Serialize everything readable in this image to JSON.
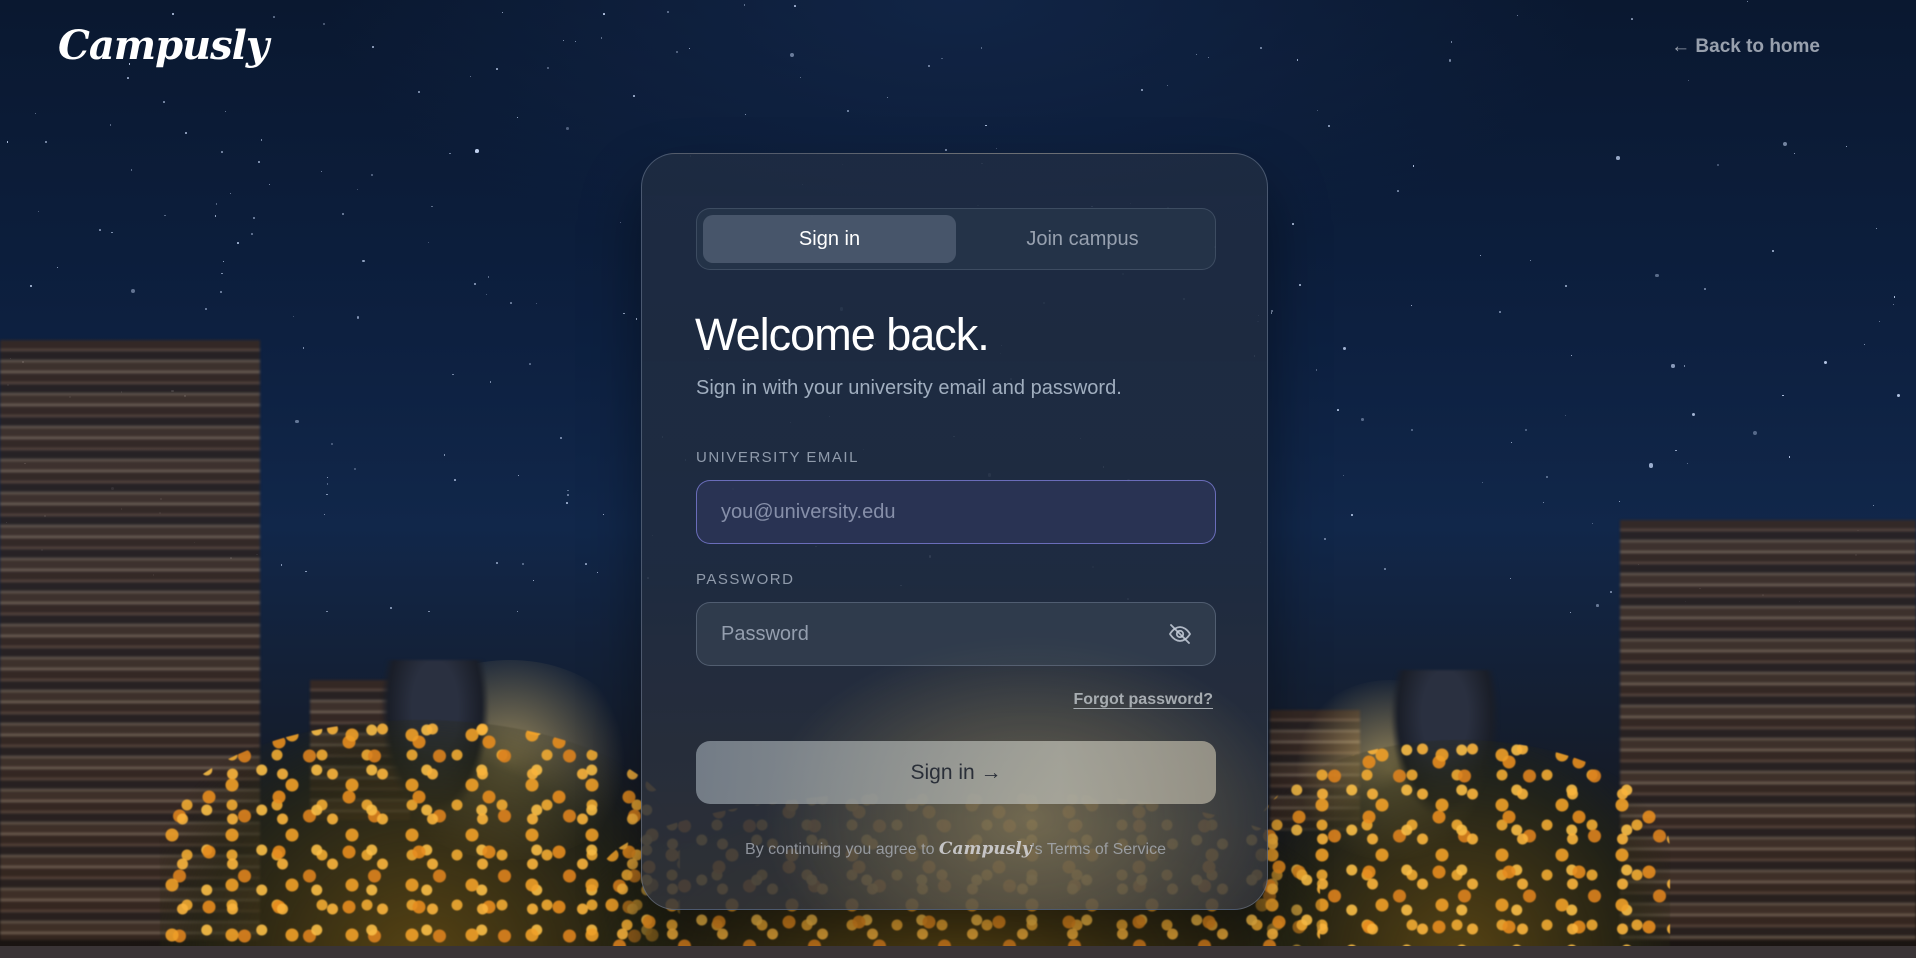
{
  "header": {
    "logo_text": "Campusly",
    "back_link": "← Back to home"
  },
  "auth": {
    "tabs": [
      {
        "label": "Sign in",
        "active": true
      },
      {
        "label": "Join campus",
        "active": false
      }
    ],
    "heading": "Welcome back.",
    "subheading": "Sign in with your university email and password.",
    "email": {
      "label": "UNIVERSITY EMAIL",
      "placeholder": "you@university.edu",
      "value": ""
    },
    "password": {
      "label": "PASSWORD",
      "placeholder": "Password",
      "value": "",
      "toggle_icon": "eye-off-icon"
    },
    "forgot_link": "Forgot password?",
    "submit_label": "Sign in →",
    "terms": {
      "prefix": "By continuing you agree to ",
      "brand": "Campusly",
      "suffix": "'s Terms of Service"
    }
  },
  "colors": {
    "email_focus_border": "#8282dc",
    "background_night": "#0d2040",
    "flower_accent": "#f0a028"
  }
}
